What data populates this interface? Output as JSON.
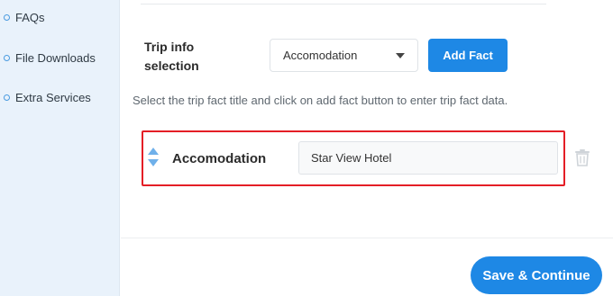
{
  "sidebar": {
    "items": [
      {
        "label": "FAQs",
        "icon": "circle-bullet-icon"
      },
      {
        "label": "File Downloads",
        "icon": "circle-bullet-icon"
      },
      {
        "label": "Extra Services",
        "icon": "circle-bullet-icon"
      }
    ]
  },
  "trip_info": {
    "label": "Trip info selection",
    "select_value": "Accomodation",
    "add_button": "Add Fact",
    "help_text": "Select the trip fact title and click on add fact button to enter trip fact data."
  },
  "fact_row": {
    "title": "Accomodation",
    "value": "Star View Hotel",
    "highlight_color": "#e41e26"
  },
  "footer": {
    "save_button": "Save & Continue"
  },
  "colors": {
    "accent": "#1e88e5",
    "sidebar_bg": "#e9f2fb"
  }
}
